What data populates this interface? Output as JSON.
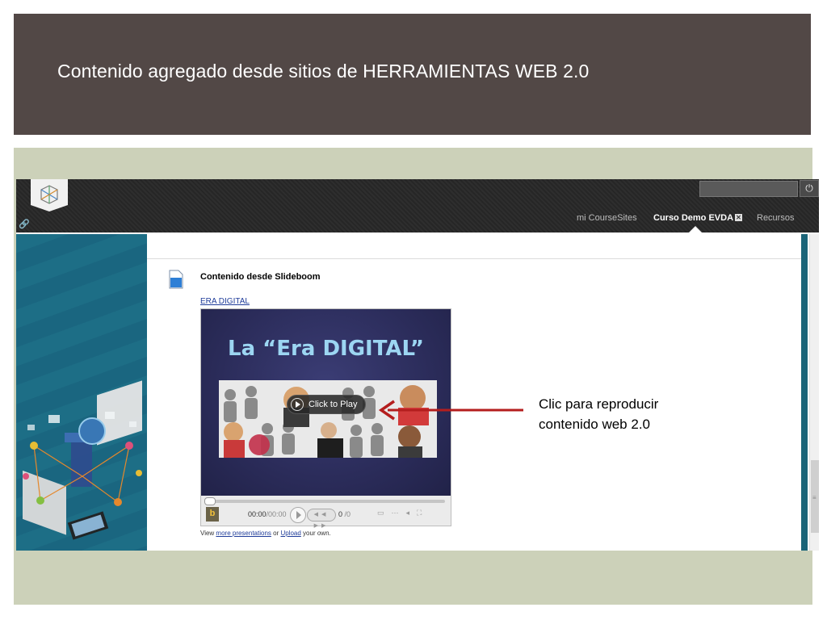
{
  "slide_title": "Contenido agregado desde sitios de HERRAMIENTAS WEB 2.0",
  "colors": {
    "title_band": "#524846",
    "content_band": "#ccd1b9",
    "annotation_arrow": "#b41e1e"
  },
  "screenshot": {
    "top_nav": {
      "items": [
        {
          "label": "mi CourseSites",
          "active": false
        },
        {
          "label": "Curso Demo EVDA",
          "active": true,
          "badge": "✕"
        },
        {
          "label": "Recursos",
          "active": false
        }
      ],
      "power_icon": "⏻",
      "link_icon": "🔗"
    },
    "content_item": {
      "title": "Contenido desde Slideboom",
      "link_label": "ERA DIGITAL"
    },
    "player": {
      "slide_heading": "La “Era DIGITAL”",
      "click_to_play": "Click to Play",
      "progress": 0,
      "time_current": "00:00",
      "time_total": "/00:00",
      "slide_current": "0",
      "slide_total": "/0",
      "brand_glyph": "b"
    },
    "footer": {
      "prefix": "View ",
      "link1": "more presentations",
      "middle": " or ",
      "link2": "Upload",
      "suffix": " your own."
    }
  },
  "annotation": {
    "line1": "Clic para reproducir",
    "line2": "contenido web 2.0"
  }
}
